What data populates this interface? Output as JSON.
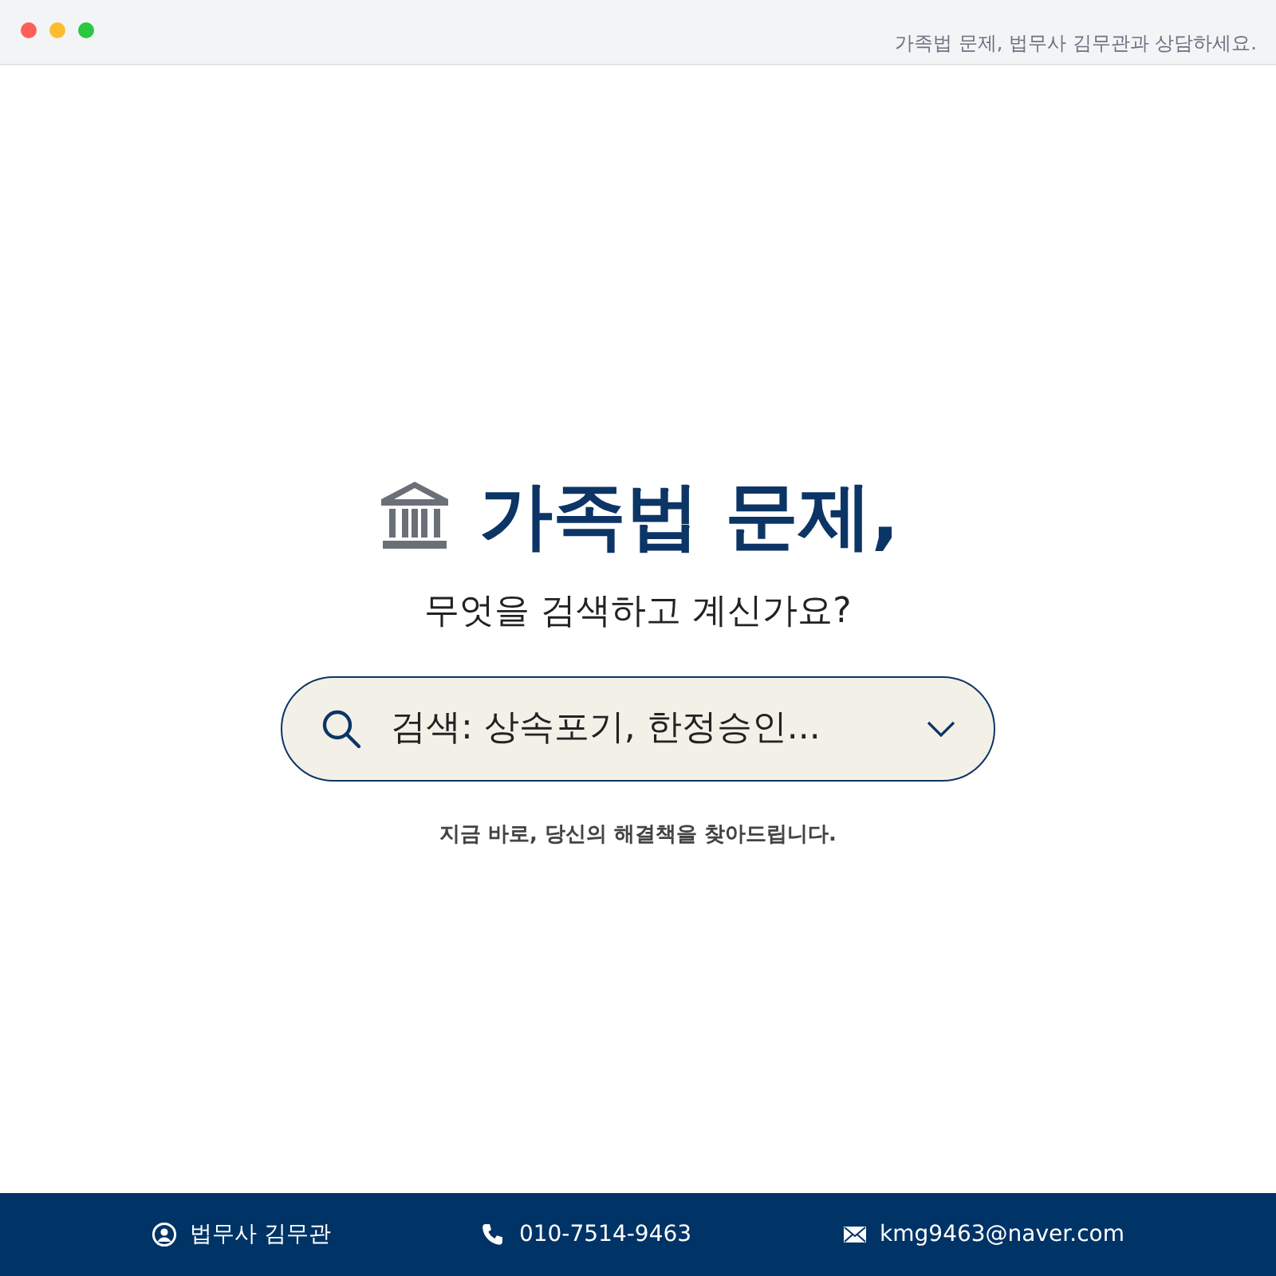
{
  "window": {
    "title": "가족법 문제, 법무사 김무관과 상담하세요."
  },
  "hero": {
    "heading": "가족법 문제,",
    "subheading": "무엇을 검색하고 계신가요?"
  },
  "search": {
    "placeholder": "검색: 상속포기, 한정승인..."
  },
  "tagline": "지금 바로, 당신의 해결책을 찾아드립니다.",
  "footer": [
    {
      "kind": "person",
      "text": "법무사 김무관"
    },
    {
      "kind": "phone",
      "text": "010-7514-9463"
    },
    {
      "kind": "mail",
      "text": "kmg9463@naver.com"
    }
  ]
}
